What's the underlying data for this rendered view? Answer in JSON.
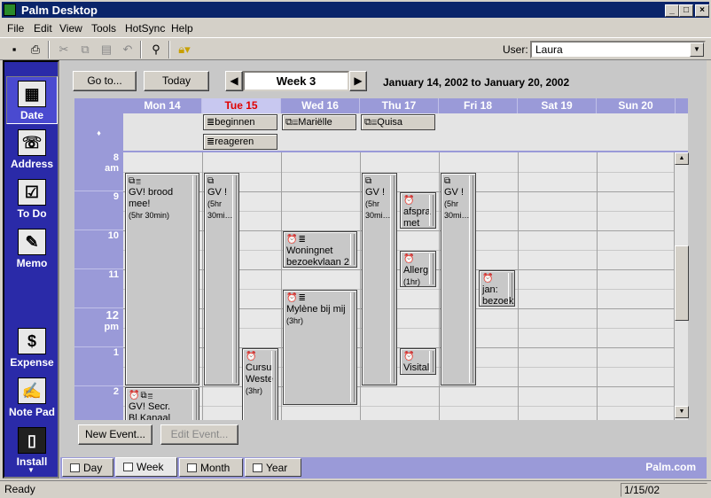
{
  "window": {
    "title": "Palm Desktop"
  },
  "menu": [
    "File",
    "Edit",
    "View",
    "Tools",
    "HotSync",
    "Help"
  ],
  "user": {
    "label": "User:",
    "value": "Laura"
  },
  "launcher": [
    {
      "label": "Date",
      "icon": "calendar-icon"
    },
    {
      "label": "Address",
      "icon": "phone-icon"
    },
    {
      "label": "To Do",
      "icon": "checklist-icon"
    },
    {
      "label": "Memo",
      "icon": "memo-pen-icon"
    },
    {
      "label": "Expense",
      "icon": "dollar-icon"
    },
    {
      "label": "Note Pad",
      "icon": "notepad-icon"
    },
    {
      "label": "Install",
      "icon": "handheld-icon"
    }
  ],
  "nav": {
    "goto": "Go to...",
    "today": "Today",
    "week": "Week 3",
    "range": "January 14, 2002 to January 20, 2002"
  },
  "days": [
    "Mon 14",
    "Tue 15",
    "Wed 16",
    "Thu 17",
    "Fri 18",
    "Sat 19",
    "Sun 20"
  ],
  "today_index": 1,
  "untimed_marker": "♦",
  "untimed_events": [
    {
      "day": 1,
      "text": "beginnen"
    },
    {
      "day": 1,
      "text": "reageren"
    },
    {
      "day": 2,
      "text": "Mariëlle"
    },
    {
      "day": 3,
      "text": "Quisa"
    }
  ],
  "hours": [
    {
      "h": "8",
      "ampm": "am"
    },
    {
      "h": "9",
      "ampm": ""
    },
    {
      "h": "10",
      "ampm": ""
    },
    {
      "h": "11",
      "ampm": ""
    },
    {
      "h": "12",
      "ampm": "pm"
    },
    {
      "h": "1",
      "ampm": ""
    },
    {
      "h": "2",
      "ampm": ""
    }
  ],
  "events": [
    {
      "title": "GV! brood mee!",
      "duration": "(5hr 30min)",
      "icons": "⧉≣"
    },
    {
      "title": "GV !",
      "duration": "(5hr 30mi…",
      "icons": "⧉"
    },
    {
      "title": "Cursu Weste",
      "duration": "(3hr)",
      "icons": "⏰"
    },
    {
      "title": "Woningnet bezoekvlaan 2",
      "duration": "",
      "icons": "⏰≣"
    },
    {
      "title": "Mylène bij mij",
      "duration": "(3hr)",
      "icons": "⏰≣"
    },
    {
      "title": "GV !",
      "duration": "(5hr 30mi…",
      "icons": "⧉"
    },
    {
      "title": "afspra met",
      "duration": "",
      "icons": "⏰"
    },
    {
      "title": "Allerg",
      "duration": "(1hr)",
      "icons": "⏰"
    },
    {
      "title": "Visital",
      "duration": "",
      "icons": "⏰"
    },
    {
      "title": "GV !",
      "duration": "(5hr 30mi…",
      "icons": "⧉"
    },
    {
      "title": "jan: bezoek",
      "duration": "",
      "icons": "⏰"
    },
    {
      "title": "GV! Secr. Bl.Kanaal",
      "duration": "",
      "icons": "⏰⧉≣"
    }
  ],
  "actions": {
    "new_event": "New Event...",
    "edit_event": "Edit Event..."
  },
  "tabs": [
    "Day",
    "Week",
    "Month",
    "Year"
  ],
  "selected_tab": "Week",
  "brand": "Palm.com",
  "status": {
    "left": "Ready",
    "date": "1/15/02"
  }
}
